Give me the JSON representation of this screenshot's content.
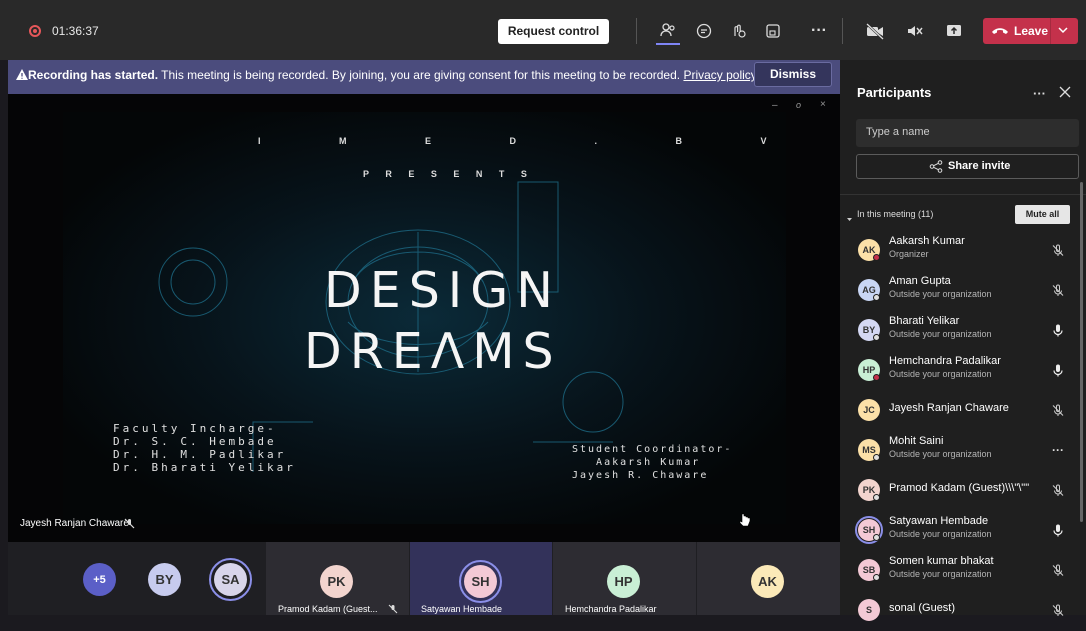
{
  "topbar": {
    "timer": "01:36:37",
    "request_control": "Request control",
    "leave": "Leave"
  },
  "banner": {
    "bold": "Recording has started.",
    "text": " This meeting is being recorded. By joining, you are giving consent for this meeting to be recorded. ",
    "link": "Privacy policy",
    "dismiss": "Dismiss"
  },
  "slide": {
    "org": "I M E D . B V p",
    "presents": "P R E S E N T S",
    "title_line1": "DESIGN",
    "title_line2": "DREΛΜS",
    "faculty": "Faculty Incharge-\nDr. S. C. Hembade\nDr. H. M. Padlikar\nDr. Bharati Yelikar",
    "student": "Student Coordinator-\n   Aakarsh Kumar\nJayesh R. Chaware"
  },
  "stage": {
    "speaker_name": "Jayesh Ranjan Chaware"
  },
  "filmstrip": {
    "overflow": "+5",
    "avatars": [
      {
        "initials": "BY",
        "color": "#c7cbee"
      },
      {
        "initials": "SA",
        "color": "#d8d5ea"
      }
    ],
    "tiles": [
      {
        "initials": "PK",
        "name": "Pramod Kadam (Guest...",
        "color": "#f2d4ce"
      },
      {
        "initials": "SH",
        "name": "Satyawan Hembade",
        "color": "#f3c9d5"
      },
      {
        "initials": "HP",
        "name": "Hemchandra Padalikar",
        "color": "#c9efd5"
      },
      {
        "initials": "AK",
        "name": "",
        "color": "#fbe9b8"
      }
    ]
  },
  "panel": {
    "title": "Participants",
    "search_placeholder": "Type a name",
    "share_invite": "Share invite",
    "section": "In this meeting (11)",
    "mute_all": "Mute all",
    "participants": [
      {
        "initials": "AK",
        "name": "Aakarsh Kumar",
        "sub": "Organizer",
        "color": "#fbe0a8",
        "mic": "muted",
        "status": "#c4314b"
      },
      {
        "initials": "AG",
        "name": "Aman Gupta",
        "sub": "Outside your organization",
        "color": "#c9d6f4",
        "mic": "muted",
        "status": "#e0e0e0"
      },
      {
        "initials": "BY",
        "name": "Bharati Yelikar",
        "sub": "Outside your organization",
        "color": "#d4d8f3",
        "mic": "on",
        "status": "#e0e0e0"
      },
      {
        "initials": "HP",
        "name": "Hemchandra Padalikar",
        "sub": "Outside your organization",
        "color": "#c9efd5",
        "mic": "on",
        "status": "#c4314b"
      },
      {
        "initials": "JC",
        "name": "Jayesh Ranjan Chaware",
        "sub": "",
        "color": "#fbe0a8",
        "mic": "muted",
        "status": ""
      },
      {
        "initials": "MS",
        "name": "Mohit Saini",
        "sub": "Outside your organization",
        "color": "#fbe0a8",
        "mic": "more",
        "status": "#e0e0e0"
      },
      {
        "initials": "PK",
        "name": "Pramod Kadam (Guest)\\\\\\\"\\\"\"",
        "sub": "",
        "color": "#f2d4ce",
        "mic": "muted",
        "status": "#e0e0e0"
      },
      {
        "initials": "SH",
        "name": "Satyawan Hembade",
        "sub": "Outside your organization",
        "color": "#f3c9d5",
        "mic": "on",
        "status": "#e0e0e0"
      },
      {
        "initials": "SB",
        "name": "Somen kumar bhakat",
        "sub": "Outside your organization",
        "color": "#f3c9d5",
        "mic": "muted",
        "status": "#e0e0e0"
      },
      {
        "initials": "S",
        "name": "sonal (Guest)",
        "sub": "",
        "color": "#f3c9d5",
        "mic": "muted",
        "status": ""
      }
    ]
  }
}
